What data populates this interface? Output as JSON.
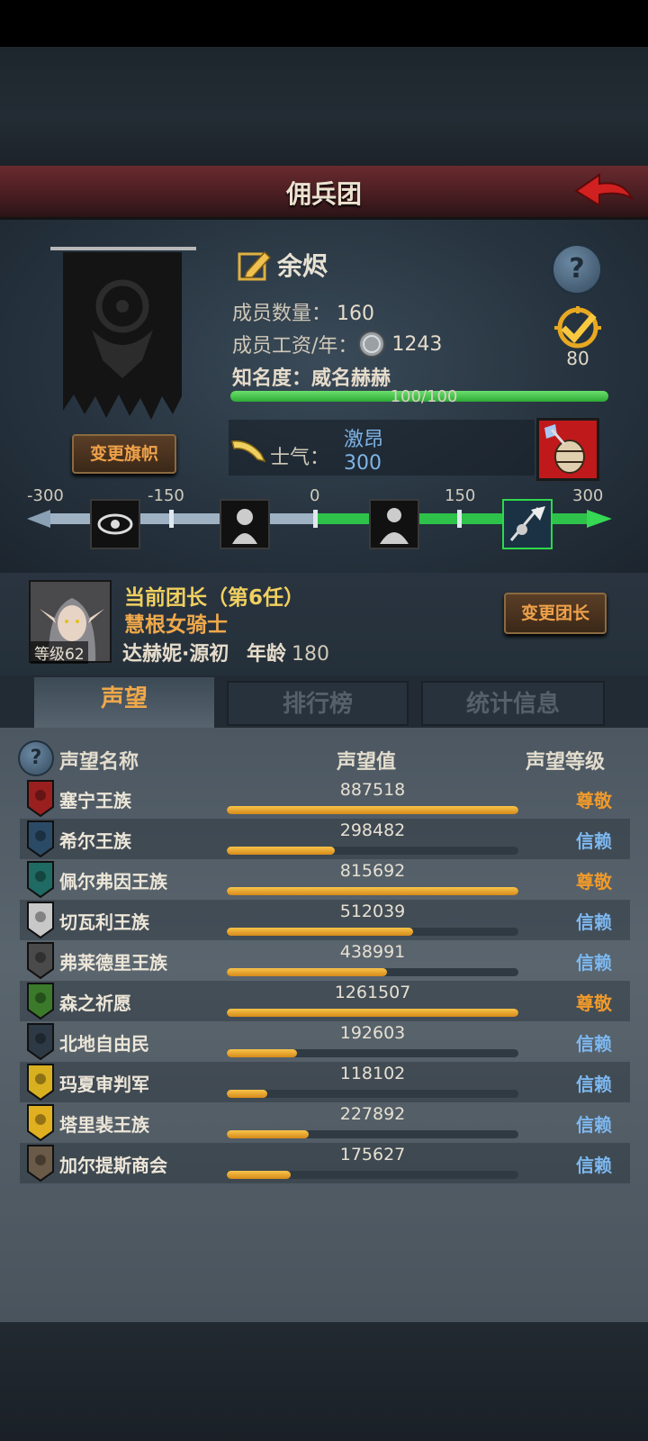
{
  "title": "佣兵团",
  "guild": {
    "name": "余烬",
    "members_label": "成员数量：",
    "members": "160",
    "wage_label": "成员工资/年：",
    "wage": "1243",
    "fame_label": "知名度：",
    "fame_title": "威名赫赫",
    "fame_progress_text": "100/100",
    "fame_fraction": 1.0,
    "badge_value": "80",
    "change_banner_label": "变更旗帜"
  },
  "morale": {
    "label": "士气：",
    "state": "激昂",
    "value": "300",
    "scale_ticks": [
      "-300",
      "-150",
      "0",
      "150",
      "300"
    ],
    "icons": [
      "fear-eye-icon",
      "despair-icon",
      "calm-icon",
      "heroic-charge-icon"
    ]
  },
  "leader": {
    "header": "当前团长（第6任）",
    "class_name": "慧根女骑士",
    "level_label": "等级62",
    "name": "达赫妮·源初",
    "age_label": "年龄",
    "age": "180",
    "change_label": "变更团长"
  },
  "tabs": [
    {
      "label": "声望",
      "active": true
    },
    {
      "label": "排行榜",
      "active": false
    },
    {
      "label": "统计信息",
      "active": false
    }
  ],
  "table": {
    "col_name": "声望名称",
    "col_value": "声望值",
    "col_level": "声望等级",
    "rows": [
      {
        "name": "塞宁王族",
        "value": "887518",
        "level": "尊敬",
        "fill": 1.0,
        "icon": "red-crest-icon",
        "icon_color": "#9a1f1f"
      },
      {
        "name": "希尔王族",
        "value": "298482",
        "level": "信赖",
        "fill": 0.37,
        "icon": "blue-hood-icon",
        "icon_color": "#2b4a66"
      },
      {
        "name": "佩尔弗因王族",
        "value": "815692",
        "level": "尊敬",
        "fill": 1.0,
        "icon": "teal-castle-icon",
        "icon_color": "#1f6a62"
      },
      {
        "name": "切瓦利王族",
        "value": "512039",
        "level": "信赖",
        "fill": 0.64,
        "icon": "scales-icon",
        "icon_color": "#c8c8c8"
      },
      {
        "name": "弗莱德里王族",
        "value": "438991",
        "level": "信赖",
        "fill": 0.55,
        "icon": "grey-mask-icon",
        "icon_color": "#4a4a4a"
      },
      {
        "name": "森之祈愿",
        "value": "1261507",
        "level": "尊敬",
        "fill": 1.0,
        "icon": "tree-icon",
        "icon_color": "#3a7a2a"
      },
      {
        "name": "北地自由民",
        "value": "192603",
        "level": "信赖",
        "fill": 0.24,
        "icon": "axe-horns-icon",
        "icon_color": "#2d3a46"
      },
      {
        "name": "玛夏审判军",
        "value": "118102",
        "level": "信赖",
        "fill": 0.14,
        "icon": "gold-cross-icon",
        "icon_color": "#d8b020"
      },
      {
        "name": "塔里裴王族",
        "value": "227892",
        "level": "信赖",
        "fill": 0.28,
        "icon": "gold-crown-icon",
        "icon_color": "#e0b020"
      },
      {
        "name": "加尔提斯商会",
        "value": "175627",
        "level": "信赖",
        "fill": 0.22,
        "icon": "merchant-icon",
        "icon_color": "#6a5a48"
      }
    ]
  },
  "colors": {
    "respect": "#f09a2a",
    "trust": "#7db8f0"
  }
}
